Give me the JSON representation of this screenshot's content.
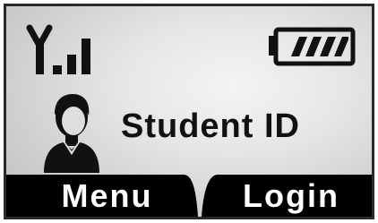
{
  "screen": {
    "title": "Student ID"
  },
  "status": {
    "signal_icon": "signal-strength-icon",
    "signal_bars_filled": 3,
    "battery_icon": "battery-icon",
    "battery_level_fraction": 0.8
  },
  "avatar_icon": "user-avatar-icon",
  "softkeys": {
    "left_label": "Menu",
    "right_label": "Login"
  },
  "colors": {
    "text": "#111111",
    "softkey_background": "#000000",
    "softkey_text": "#ffffff"
  }
}
